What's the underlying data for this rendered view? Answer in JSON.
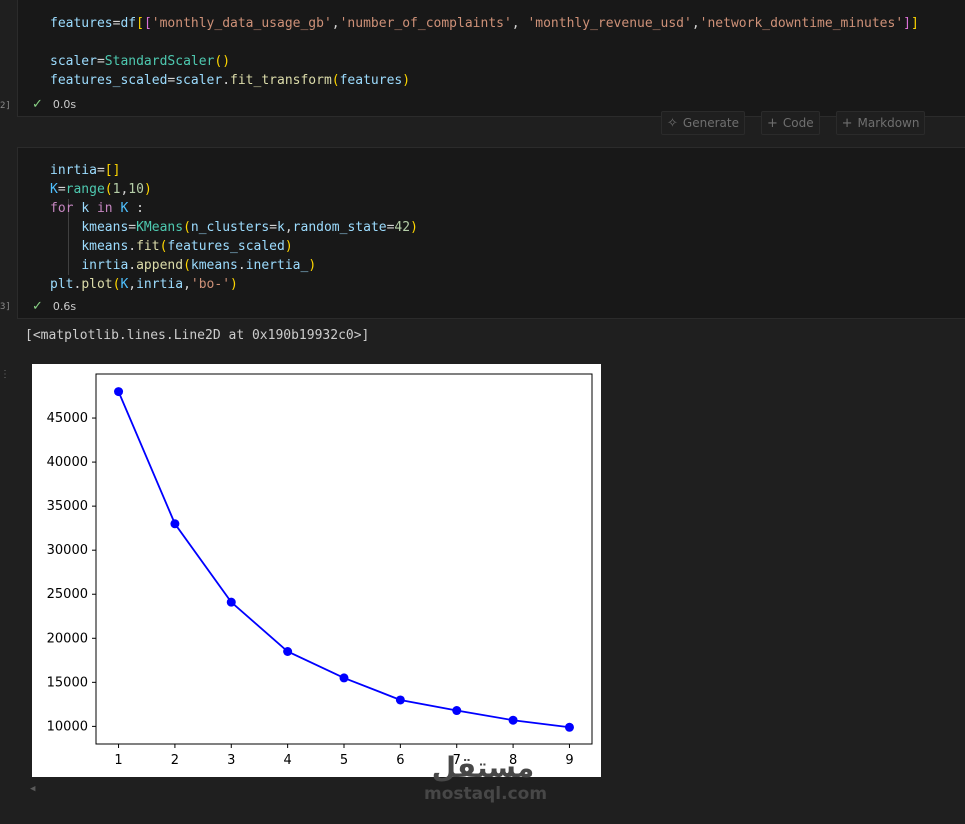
{
  "cell1": {
    "exec_count": "2]",
    "status_time": "0.0s",
    "lines": [
      "features=df[['monthly_data_usage_gb','number_of_complaints', 'monthly_revenue_usd','network_downtime_minutes']]",
      "",
      "scaler=StandardScaler()",
      "features_scaled=scaler.fit_transform(features)"
    ]
  },
  "toolbar": {
    "generate_label": "Generate",
    "code_label": "Code",
    "markdown_label": "Markdown"
  },
  "cell2": {
    "exec_count": "3]",
    "status_time": "0.6s",
    "lines": [
      "inrtia=[]",
      "K=range(1,10)",
      "for k in K :",
      "    kmeans=KMeans(n_clusters=k,random_state=42)",
      "    kmeans.fit(features_scaled)",
      "    inrtia.append(kmeans.inertia_)",
      "plt.plot(K,inrtia,'bo-')"
    ]
  },
  "output": {
    "text": "[<matplotlib.lines.Line2D at 0x190b19932c0>]"
  },
  "chart_data": {
    "type": "line",
    "title": "",
    "xlabel": "",
    "ylabel": "",
    "x": [
      1,
      2,
      3,
      4,
      5,
      6,
      7,
      8,
      9
    ],
    "series": [
      {
        "values": [
          48000,
          33000,
          24100,
          18500,
          15500,
          13000,
          11800,
          10700,
          9900
        ],
        "color": "#0000ff",
        "marker": "circle"
      }
    ],
    "xlim": [
      0.6,
      9.4
    ],
    "ylim": [
      8000,
      50000
    ],
    "xticks": [
      "1",
      "2",
      "3",
      "4",
      "5",
      "6",
      "7",
      "8",
      "9"
    ],
    "yticks": [
      "10000",
      "15000",
      "20000",
      "25000",
      "30000",
      "35000",
      "40000",
      "45000"
    ],
    "grid": false
  },
  "watermark": {
    "arabic": "مستقل",
    "latin": "mostaql.com"
  }
}
